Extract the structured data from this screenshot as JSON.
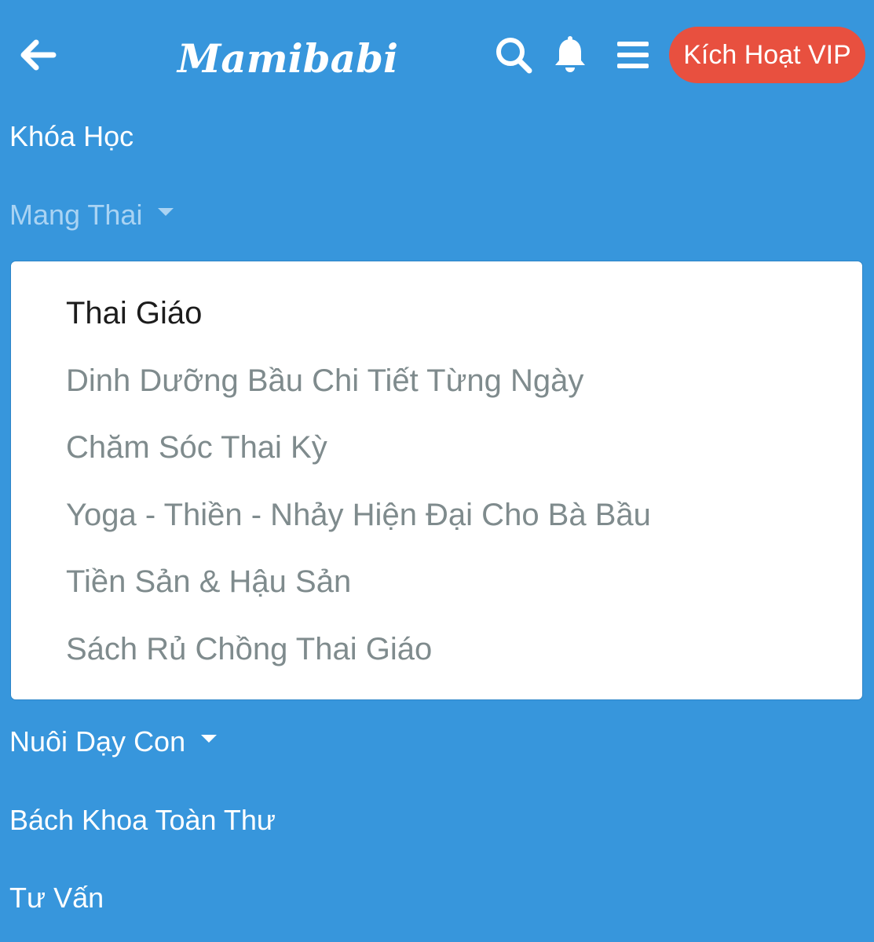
{
  "header": {
    "logo": "Mamibabi",
    "vip_button": "Kích Hoạt VIP",
    "icons": [
      "back-arrow-icon",
      "search-icon",
      "bell-icon",
      "hamburger-menu-icon"
    ]
  },
  "nav": {
    "items": [
      {
        "label": "Khóa Học"
      },
      {
        "label": "Mang Thai"
      },
      {
        "label": "Nuôi Dạy Con"
      },
      {
        "label": "Bách Khoa Toàn Thư"
      },
      {
        "label": "Tư Vấn"
      }
    ]
  },
  "dropdown": {
    "items": [
      {
        "label": "Thai Giáo"
      },
      {
        "label": "Dinh Dưỡng Bầu Chi Tiết Từng Ngày"
      },
      {
        "label": "Chăm Sóc Thai Kỳ"
      },
      {
        "label": "Yoga - Thiền - Nhảy Hiện Đại Cho Bà Bầu"
      },
      {
        "label": "Tiền Sản & Hậu Sản"
      },
      {
        "label": "Sách Rủ Chồng Thai Giáo"
      }
    ]
  },
  "colors": {
    "background": "#3796dc",
    "vip_button": "#e8503f",
    "active_nav": "#a9d3f3",
    "dropdown_selected": "#1c1c1c",
    "dropdown_item": "#7f8b8d"
  }
}
